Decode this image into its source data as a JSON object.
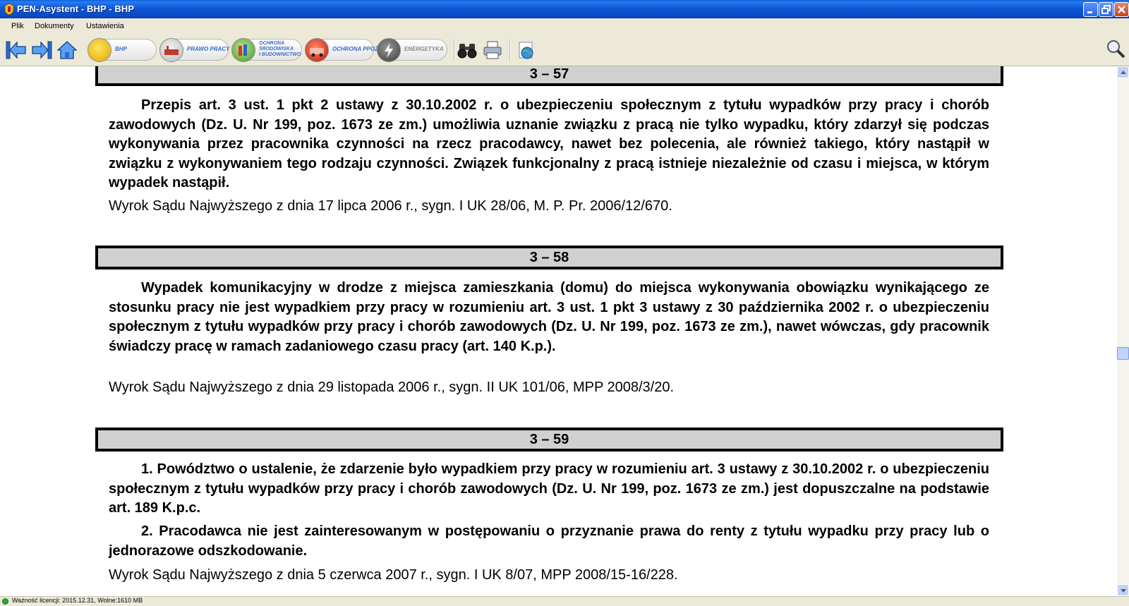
{
  "window": {
    "title": "PEN-Asystent - BHP - BHP"
  },
  "menu": [
    "Plik",
    "Dokumenty",
    "Ustawienia"
  ],
  "toolbar": {
    "categories": [
      {
        "label": "BHP"
      },
      {
        "label": "PRAWO PRACY"
      },
      {
        "label_lines": [
          "OCHRONA",
          "ŚRODOWISKA",
          "I BUDOWNICTWO"
        ]
      },
      {
        "label": "OCHRONA PPOŻ"
      },
      {
        "label": "ENERGETYKA"
      }
    ]
  },
  "document": {
    "sections": [
      {
        "number": "3 – 57",
        "paragraphs": [
          "Przepis art. 3 ust. 1 pkt 2 ustawy z 30.10.2002 r. o ubezpieczeniu społecznym z tytułu wypadków przy pracy i chorób zawodowych (Dz. U. Nr 199, poz. 1673 ze zm.) umożliwia uznanie związku z pracą nie tylko wypadku, który zdarzył się podczas wykonywania przez pracownika czynności na rzecz pracodawcy, nawet bez polecenia, ale również takiego, który nastąpił w związku z wykonywaniem tego rodzaju czynności. Związek funkcjonalny z pracą istnieje niezależnie od czasu i miejsca, w którym wypadek nastąpił."
        ],
        "citation": "Wyrok Sądu Najwyższego z dnia 17 lipca 2006 r., sygn. I UK 28/06, M. P. Pr. 2006/12/670."
      },
      {
        "number": "3 – 58",
        "paragraphs": [
          "Wypadek komunikacyjny w drodze z miejsca zamieszkania (domu) do miejsca wykonywania obowiązku wynikającego ze stosunku pracy nie jest wypadkiem przy pracy w rozumieniu art. 3 ust. 1 pkt 3 ustawy z 30 października 2002 r. o ubezpieczeniu społecznym z tytułu wypadków przy pracy i chorób zawodowych (Dz. U. Nr 199, poz. 1673 ze zm.), nawet wówczas, gdy pracownik świadczy pracę w ramach zadaniowego czasu pracy (art. 140 K.p.)."
        ],
        "citation": "Wyrok Sądu Najwyższego z dnia 29 listopada 2006 r., sygn. II UK 101/06, MPP 2008/3/20."
      },
      {
        "number": "3 – 59",
        "paragraphs": [
          "1. Powództwo o ustalenie, że zdarzenie było wypadkiem przy pracy w rozumieniu art. 3 ustawy z 30.10.2002 r. o ubezpieczeniu społecznym z tytułu wypadków przy pracy i chorób zawodowych (Dz. U. Nr 199, poz. 1673 ze zm.) jest dopuszczalne na podstawie art. 189 K.p.c.",
          "2. Pracodawca nie jest zainteresowanym w postępowaniu o przyznanie prawa do renty z tytułu wypadku przy pracy lub o jednorazowe odszkodowanie."
        ],
        "citation": "Wyrok Sądu Najwyższego z dnia 5 czerwca 2007 r., sygn. I UK 8/07, MPP 2008/15-16/228."
      }
    ]
  },
  "status": {
    "text": "Ważność licencji: 2015.12.31, Wolne:1610 MB"
  },
  "colors": {
    "titlebar": "#0a5fd8",
    "section_header_bg": "#d0d0d0",
    "link_label": "#3a6fc8"
  }
}
